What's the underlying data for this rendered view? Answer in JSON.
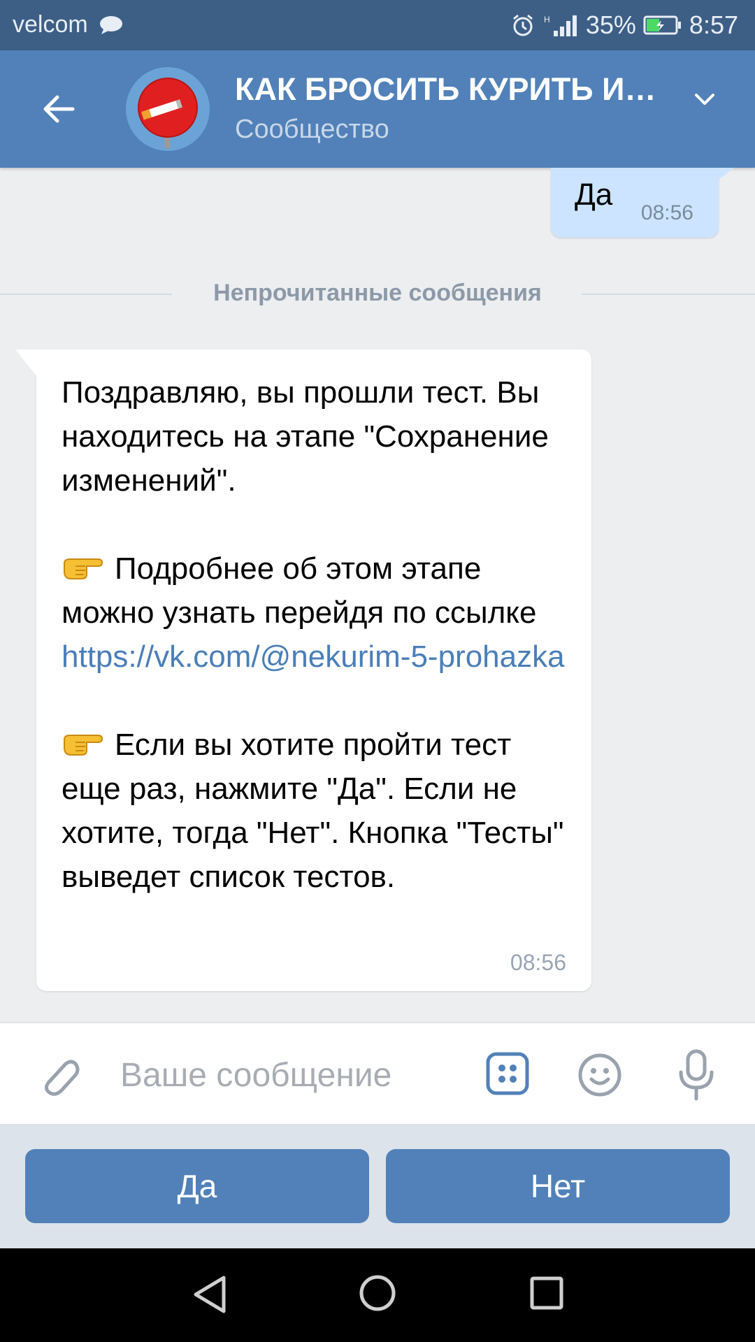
{
  "status_bar": {
    "carrier": "velcom",
    "battery": "35%",
    "time": "8:57",
    "icons": [
      "chat-bubble-icon",
      "alarm-icon",
      "signal-icon",
      "battery-icon"
    ]
  },
  "header": {
    "title": "КАК БРОСИТЬ КУРИТЬ И…",
    "subtitle": "Сообщество",
    "icons": [
      "back-arrow-icon",
      "no-smoking-avatar",
      "chevron-down-icon"
    ]
  },
  "messages": {
    "outgoing": {
      "text": "Да",
      "time": "08:56"
    },
    "divider_label": "Непрочитанные сообщения",
    "incoming": {
      "line1": "Поздравляю, вы прошли тест. Вы находитесь на этапе \"Сохранение изменений\".",
      "line2_prefix": "Подробнее об этом этапе можно узнать перейдя по ссылке ",
      "line2_link": "https://vk.com/@nekurim-5-prohazka",
      "line3": "Если вы хотите пройти тест еще раз, нажмите \"Да\". Если не хотите, тогда \"Нет\". Кнопка \"Тесты\" выведет список тестов.",
      "time": "08:56"
    }
  },
  "composer": {
    "placeholder": "Ваше сообщение",
    "icons": [
      "paperclip-icon",
      "bot-keyboard-icon",
      "smile-icon",
      "microphone-icon"
    ]
  },
  "quick_replies": [
    {
      "label": "Да"
    },
    {
      "label": "Нет"
    }
  ],
  "colors": {
    "header_bg": "#5181b8",
    "status_bg": "#3d5f86",
    "outgoing_bubble": "#cce4ff",
    "link": "#4a7eb8",
    "button": "#5181b8"
  }
}
